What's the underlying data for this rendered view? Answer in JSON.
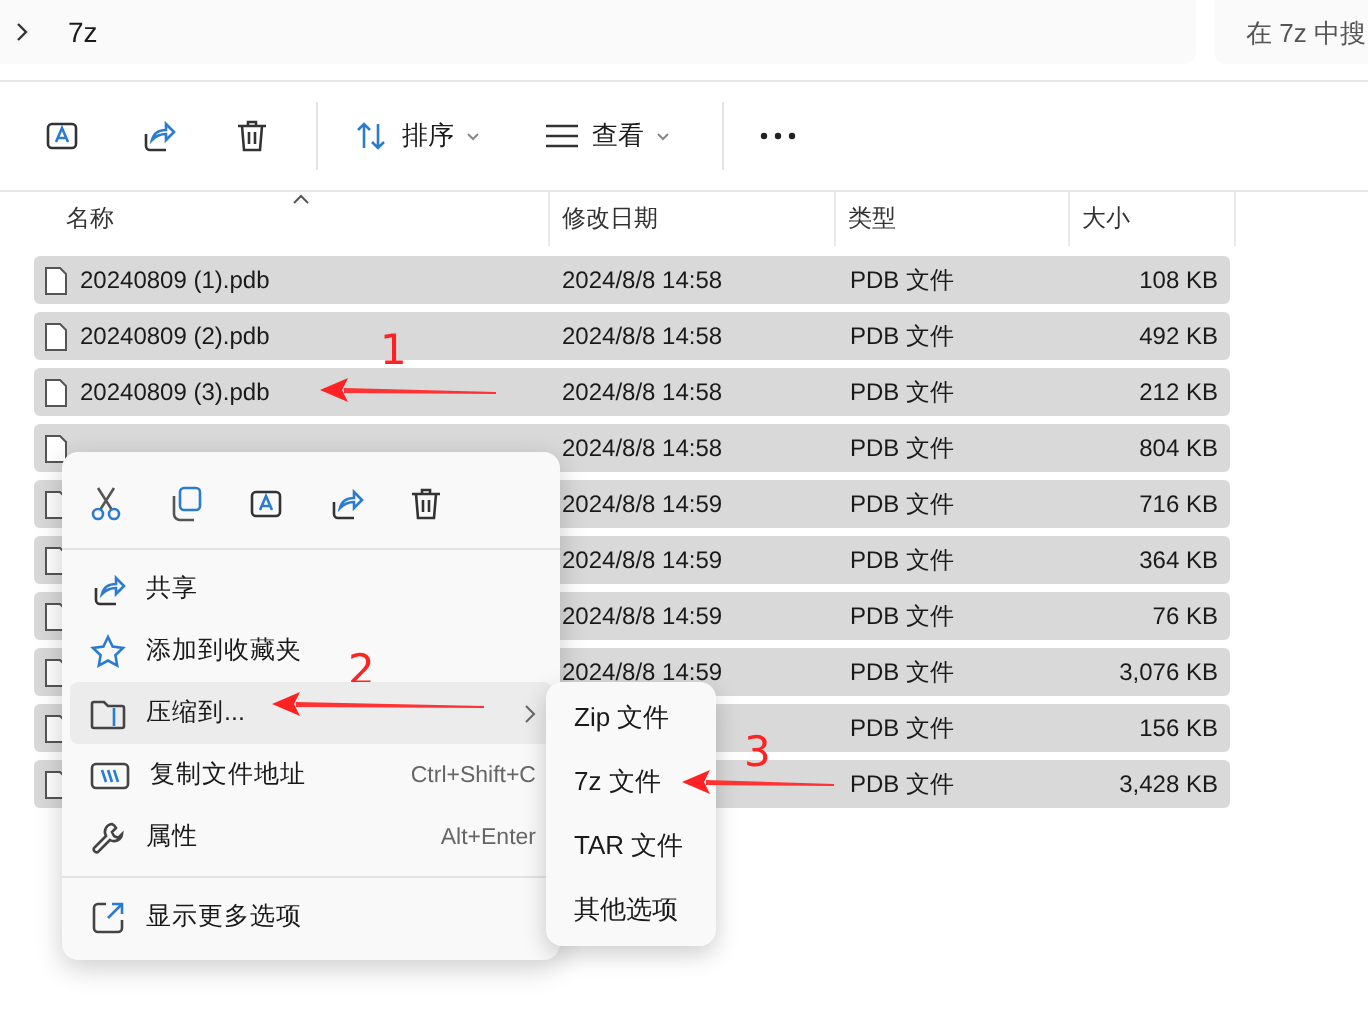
{
  "address_bar": {
    "path": "7z"
  },
  "search": {
    "placeholder": "在 7z 中搜"
  },
  "toolbar": [
    {
      "kind": "rename"
    },
    {
      "kind": "share"
    },
    {
      "kind": "delete"
    },
    {
      "kind": "sort",
      "label": "排序"
    },
    {
      "kind": "view",
      "label": "查看"
    },
    {
      "kind": "more"
    }
  ],
  "columns": [
    "名称",
    "修改日期",
    "类型",
    "大小"
  ],
  "rows": [
    {
      "name": "20240809 (1).pdb",
      "date": "2024/8/8 14:58",
      "type": "PDB 文件",
      "size": "108 KB",
      "selected": true
    },
    {
      "name": "20240809 (2).pdb",
      "date": "2024/8/8 14:58",
      "type": "PDB 文件",
      "size": "492 KB",
      "selected": true
    },
    {
      "name": "20240809 (3).pdb",
      "date": "2024/8/8 14:58",
      "type": "PDB 文件",
      "size": "212 KB",
      "selected": true
    },
    {
      "date": "2024/8/8 14:58",
      "type": "PDB 文件",
      "size": "804 KB",
      "selected": true
    },
    {
      "date": "2024/8/8 14:59",
      "type": "PDB 文件",
      "size": "716 KB",
      "selected": true
    },
    {
      "date": "2024/8/8 14:59",
      "type": "PDB 文件",
      "size": "364 KB",
      "selected": true
    },
    {
      "date": "2024/8/8 14:59",
      "type": "PDB 文件",
      "size": "76 KB",
      "selected": true
    },
    {
      "date": "2024/8/8 14:59",
      "type": "PDB 文件",
      "size": "3,076 KB",
      "selected": true
    },
    {
      "type": "PDB 文件",
      "size": "156 KB",
      "selected": true
    },
    {
      "type": "PDB 文件",
      "size": "3,428 KB",
      "selected": true
    }
  ],
  "context_menu": {
    "quick_actions": [
      {
        "kind": "cut"
      },
      {
        "kind": "copy"
      },
      {
        "kind": "rename"
      },
      {
        "kind": "share"
      },
      {
        "kind": "delete"
      }
    ],
    "items": [
      {
        "kind": "share",
        "label": "共享",
        "selected": false
      },
      {
        "kind": "star",
        "label": "添加到收藏夹",
        "selected": false
      },
      {
        "kind": "zip",
        "label": "压缩到...",
        "selected": true,
        "submenu": true
      },
      {
        "kind": "path",
        "label": "复制文件地址",
        "shortcut": "Ctrl+Shift+C",
        "selected": false
      },
      {
        "kind": "wrench",
        "label": "属性",
        "shortcut": "Alt+Enter",
        "selected": false
      },
      {
        "kind": "more",
        "label": "显示更多选项",
        "selected": false,
        "separator_before": true
      }
    ]
  },
  "submenu": [
    {
      "label": "Zip 文件"
    },
    {
      "label": "7z 文件"
    },
    {
      "label": "TAR 文件"
    },
    {
      "label": "其他选项"
    }
  ],
  "annotations": [
    {
      "label": "1"
    },
    {
      "label": "2"
    },
    {
      "label": "3"
    }
  ]
}
